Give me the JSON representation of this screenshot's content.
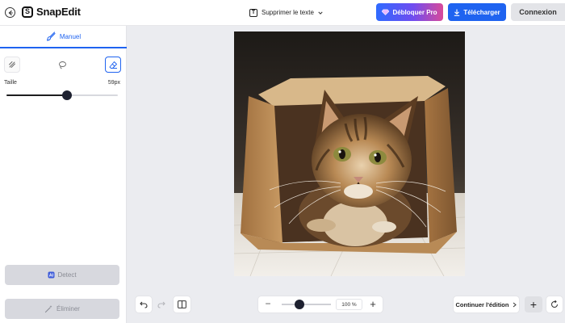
{
  "header": {
    "logo_text": "SnapEdit",
    "logo_mark": "S",
    "tool_select_label": "Supprimer le texte",
    "tool_select_icon": "text-box-icon",
    "unlock_pro_label": "Débloquer Pro",
    "download_label": "Télécharger",
    "login_label": "Connexion"
  },
  "sidebar": {
    "mode_tab_label": "Manuel",
    "tools": [
      {
        "name": "brush-icon"
      },
      {
        "name": "lasso-icon"
      },
      {
        "name": "eraser-icon",
        "active": true
      }
    ],
    "size_label": "Taille",
    "size_value": "59px",
    "size_fraction": 0.54,
    "detect_label": "Detect",
    "detect_icon": "ai-icon",
    "erase_label": "Éliminer",
    "erase_icon": "magic-wand-icon"
  },
  "bottom": {
    "zoom_value": "100 %",
    "zoom_fraction": 0.36,
    "continue_label": "Continuer l'édition"
  },
  "colors": {
    "accent": "#1f63f0",
    "canvas_bg": "#ebecf0",
    "disabled_btn": "#d7d8de"
  }
}
